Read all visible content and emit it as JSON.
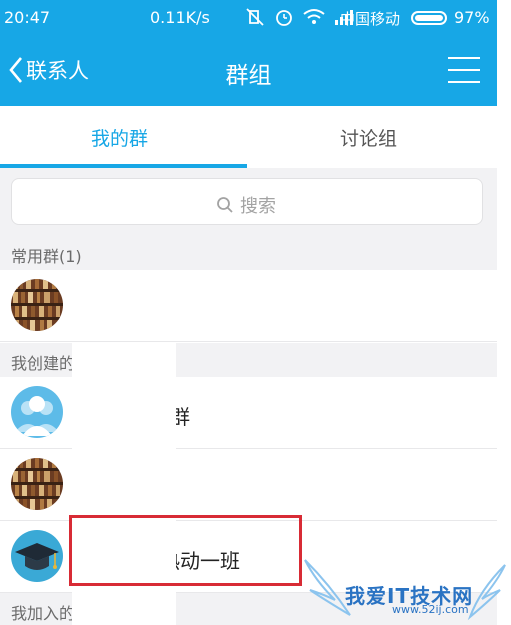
{
  "status_bar": {
    "time": "20:47",
    "net_speed": "0.11K/s",
    "carrier": "中国移动",
    "battery": "97%"
  },
  "title_bar": {
    "back_label": "联系人",
    "title": "群组",
    "menu_icon": "hamburger-icon"
  },
  "tabs": [
    {
      "label": "我的群",
      "active": true
    },
    {
      "label": "讨论组",
      "active": false
    }
  ],
  "search": {
    "placeholder": "搜索"
  },
  "sections": {
    "frequent": "常用群(1)",
    "created": "我创建的",
    "joined": "我加入的"
  },
  "rows": [
    {
      "avatar": "bookshelf-avatar",
      "label": ""
    },
    {
      "avatar": "people-avatar",
      "label": "群"
    },
    {
      "avatar": "bookshelf-avatar",
      "label": ""
    },
    {
      "avatar": "graduation-cap-avatar",
      "label": "热动一班"
    }
  ],
  "watermark": {
    "title": "我爱IT技术网",
    "url": "www.52ij.com"
  },
  "colors": {
    "accent": "#17a7e6",
    "highlight_box": "#d82b35",
    "section_bg": "#f2f2f4"
  }
}
